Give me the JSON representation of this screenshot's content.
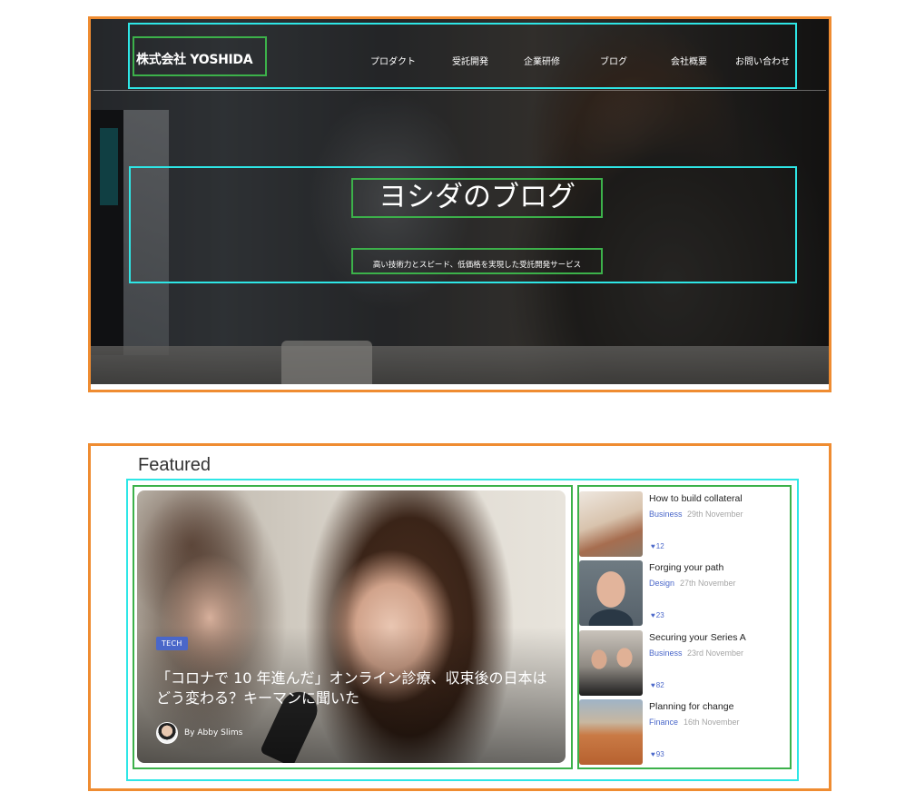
{
  "hero": {
    "logo": "株式会社 YOSHIDA",
    "nav": [
      "プロダクト",
      "受託開発",
      "企業研修",
      "ブログ",
      "会社概要",
      "お問い合わせ"
    ],
    "title": "ヨシダのブログ",
    "subtitle": "高い技術力とスピード、低価格を実現した受託開発サービス"
  },
  "featured": {
    "heading": "Featured",
    "main": {
      "tag": "TECH",
      "title": "「コロナで 10 年進んだ」オンライン診療、収束後の日本はどう変わる？キーマンに聞いた",
      "author": "By Abby Slims"
    },
    "side": [
      {
        "title": "How to build collateral",
        "category": "Business",
        "date": "29th November",
        "likes": "12"
      },
      {
        "title": "Forging your path",
        "category": "Design",
        "date": "27th November",
        "likes": "23"
      },
      {
        "title": "Securing your Series A",
        "category": "Business",
        "date": "23rd November",
        "likes": "82"
      },
      {
        "title": "Planning for change",
        "category": "Finance",
        "date": "16th November",
        "likes": "93"
      }
    ]
  },
  "colors": {
    "frame_orange": "#ef8c31",
    "frame_cyan": "#2ee6e6",
    "frame_green": "#3cb14a",
    "accent_blue": "#4a67c9"
  }
}
